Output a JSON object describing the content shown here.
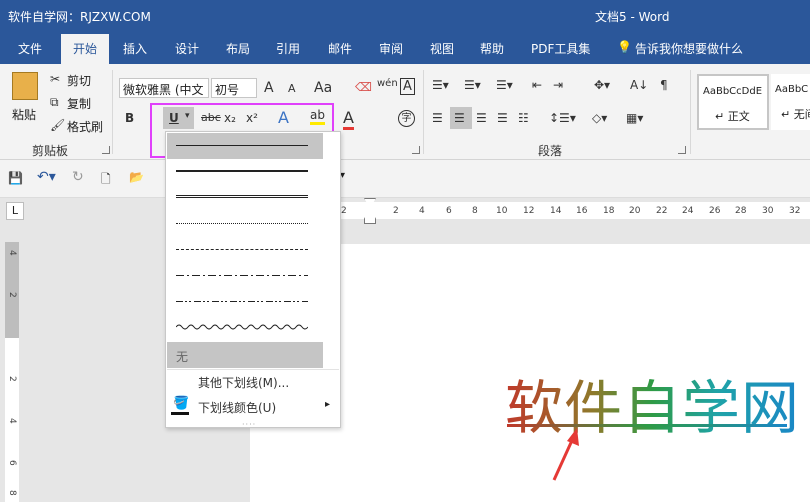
{
  "title_bar": {
    "site": "软件自学网：RJZXW.COM",
    "doc": "文档5  -  Word"
  },
  "tabs": [
    "文件",
    "开始",
    "插入",
    "设计",
    "布局",
    "引用",
    "邮件",
    "审阅",
    "视图",
    "帮助",
    "PDF工具集",
    "告诉我你想要做什么"
  ],
  "clipboard": {
    "paste": "粘贴",
    "cut": "剪切",
    "copy": "复制",
    "format_painter": "格式刷",
    "group": "剪贴板"
  },
  "font": {
    "name": "微软雅黑 (中文",
    "size": "初号",
    "grow": "A",
    "shrink": "A",
    "change_case": "Aa",
    "bold": "B",
    "italic": "I",
    "underline": "U",
    "strike": "abc",
    "subscript": "x₂",
    "superscript": "x²",
    "pinyin": "wén",
    "border": "A",
    "effect": "A",
    "color_a": "A",
    "circle": "字"
  },
  "paragraph": {
    "group": "段落"
  },
  "styles": [
    {
      "sample": "AaBbCcDdE",
      "name": "↵ 正文"
    },
    {
      "sample": "AaBbC",
      "name": "↵ 无间"
    }
  ],
  "ruler_h": [
    "2",
    "2",
    "4",
    "6",
    "8",
    "10",
    "12",
    "14",
    "16",
    "18",
    "20",
    "22",
    "24",
    "26",
    "28",
    "30",
    "32"
  ],
  "ruler_v": [
    "4",
    "2",
    "2",
    "4",
    "6",
    "8"
  ],
  "document": {
    "text": "软件自学网"
  },
  "dropdown": {
    "none": "无",
    "more": "其他下划线(M)...",
    "color": "下划线颜色(U)",
    "color_arrow": "▸",
    "dots": "····"
  }
}
